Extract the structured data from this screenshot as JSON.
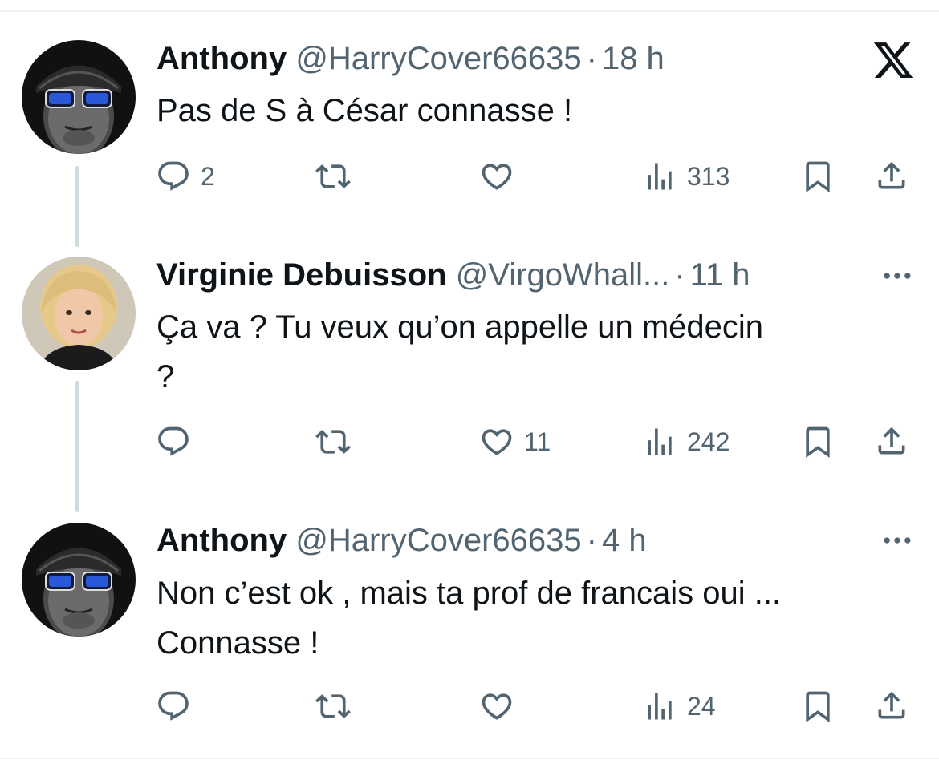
{
  "tweets": [
    {
      "author": "Anthony",
      "handle": "@HarryCover66635",
      "separator": "·",
      "time": "18 h",
      "text": "Pas de S à César connasse !",
      "replies": "2",
      "retweets": "",
      "likes": "",
      "views": "313"
    },
    {
      "author": "Virginie Debuisson",
      "handle": "@VirgoWhall...",
      "separator": "·",
      "time": "11 h",
      "text": "Ça va ? Tu veux qu’on appelle un médecin ?",
      "replies": "",
      "retweets": "",
      "likes": "11",
      "views": "242"
    },
    {
      "author": "Anthony",
      "handle": "@HarryCover66635",
      "separator": "·",
      "time": "4 h",
      "text": "Non c’est ok , mais ta prof de francais oui ... Connasse !",
      "replies": "",
      "retweets": "",
      "likes": "",
      "views": "24"
    }
  ],
  "icons": {
    "brand": "x-logo-icon",
    "reply": "reply-icon",
    "retweet": "retweet-icon",
    "like": "heart-icon",
    "views": "views-icon",
    "bookmark": "bookmark-icon",
    "share": "share-icon",
    "more": "more-icon"
  },
  "colors": {
    "text": "#0f1419",
    "secondary": "#536471",
    "thread_line": "#cfd9de",
    "divider": "#eff3f4"
  }
}
